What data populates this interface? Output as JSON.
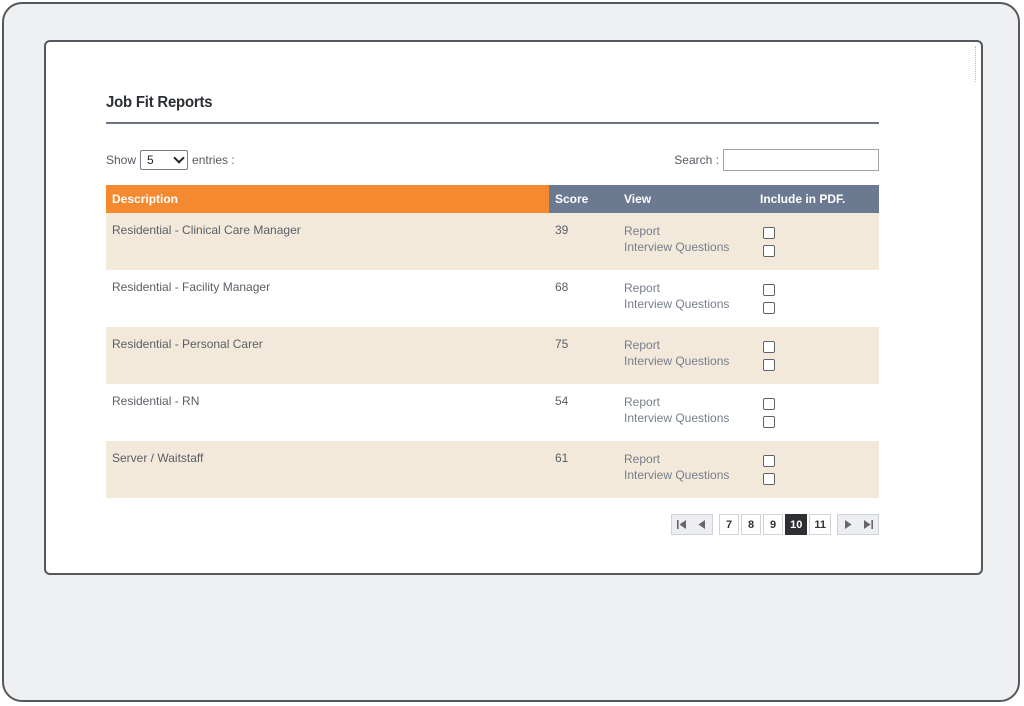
{
  "page": {
    "title": "Job Fit Reports"
  },
  "controls": {
    "show_label": "Show",
    "entries_value": "5",
    "entries_label": "entries :",
    "search_label": "Search :",
    "search_value": ""
  },
  "table": {
    "columns": [
      "Description",
      "Score",
      "View",
      "Include in PDF."
    ],
    "rows": [
      {
        "description": "Residential - Clinical Care Manager",
        "score": "39",
        "report": "Report",
        "interview": "Interview Questions"
      },
      {
        "description": "Residential - Facility Manager",
        "score": "68",
        "report": "Report",
        "interview": "Interview Questions"
      },
      {
        "description": "Residential - Personal Carer",
        "score": "75",
        "report": "Report",
        "interview": "Interview Questions"
      },
      {
        "description": "Residential - RN",
        "score": "54",
        "report": "Report",
        "interview": "Interview Questions"
      },
      {
        "description": "Server / Waitstaff",
        "score": "61",
        "report": "Report",
        "interview": "Interview Questions"
      }
    ]
  },
  "pagination": {
    "pages": [
      "7",
      "8",
      "9",
      "10",
      "11"
    ],
    "active_page": "10",
    "icons": [
      "first-page-icon",
      "previous-page-icon",
      "next-page-icon",
      "last-page-icon"
    ]
  },
  "colors": {
    "header_accent": "#f4892f",
    "header_default": "#6c7a91",
    "row_alt": "#f3e9da",
    "active_page": "#2d2f33"
  }
}
